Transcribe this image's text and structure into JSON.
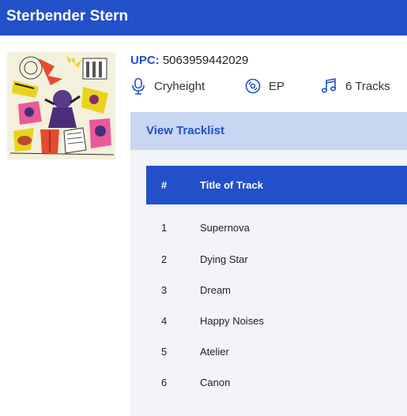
{
  "header": {
    "title": "Sterbender Stern"
  },
  "release": {
    "upc_label": "UPC:",
    "upc_value": "5063959442029",
    "artist": "Cryheight",
    "format": "EP",
    "track_count": "6 Tracks"
  },
  "tracklist": {
    "toggle_label": "View Tracklist",
    "columns": {
      "number": "#",
      "title": "Title of Track"
    },
    "tracks": [
      {
        "number": "1",
        "title": "Supernova"
      },
      {
        "number": "2",
        "title": "Dying Star"
      },
      {
        "number": "3",
        "title": "Dream"
      },
      {
        "number": "4",
        "title": "Happy Noises"
      },
      {
        "number": "5",
        "title": "Atelier"
      },
      {
        "number": "6",
        "title": "Canon"
      }
    ]
  },
  "icons": {
    "artist": "microphone-icon",
    "format": "disc-icon",
    "tracks": "music-notes-icon"
  },
  "colors": {
    "brand": "#2150c8",
    "tracklist_bar": "#c9d6f1",
    "panel": "#f3f4f7"
  }
}
